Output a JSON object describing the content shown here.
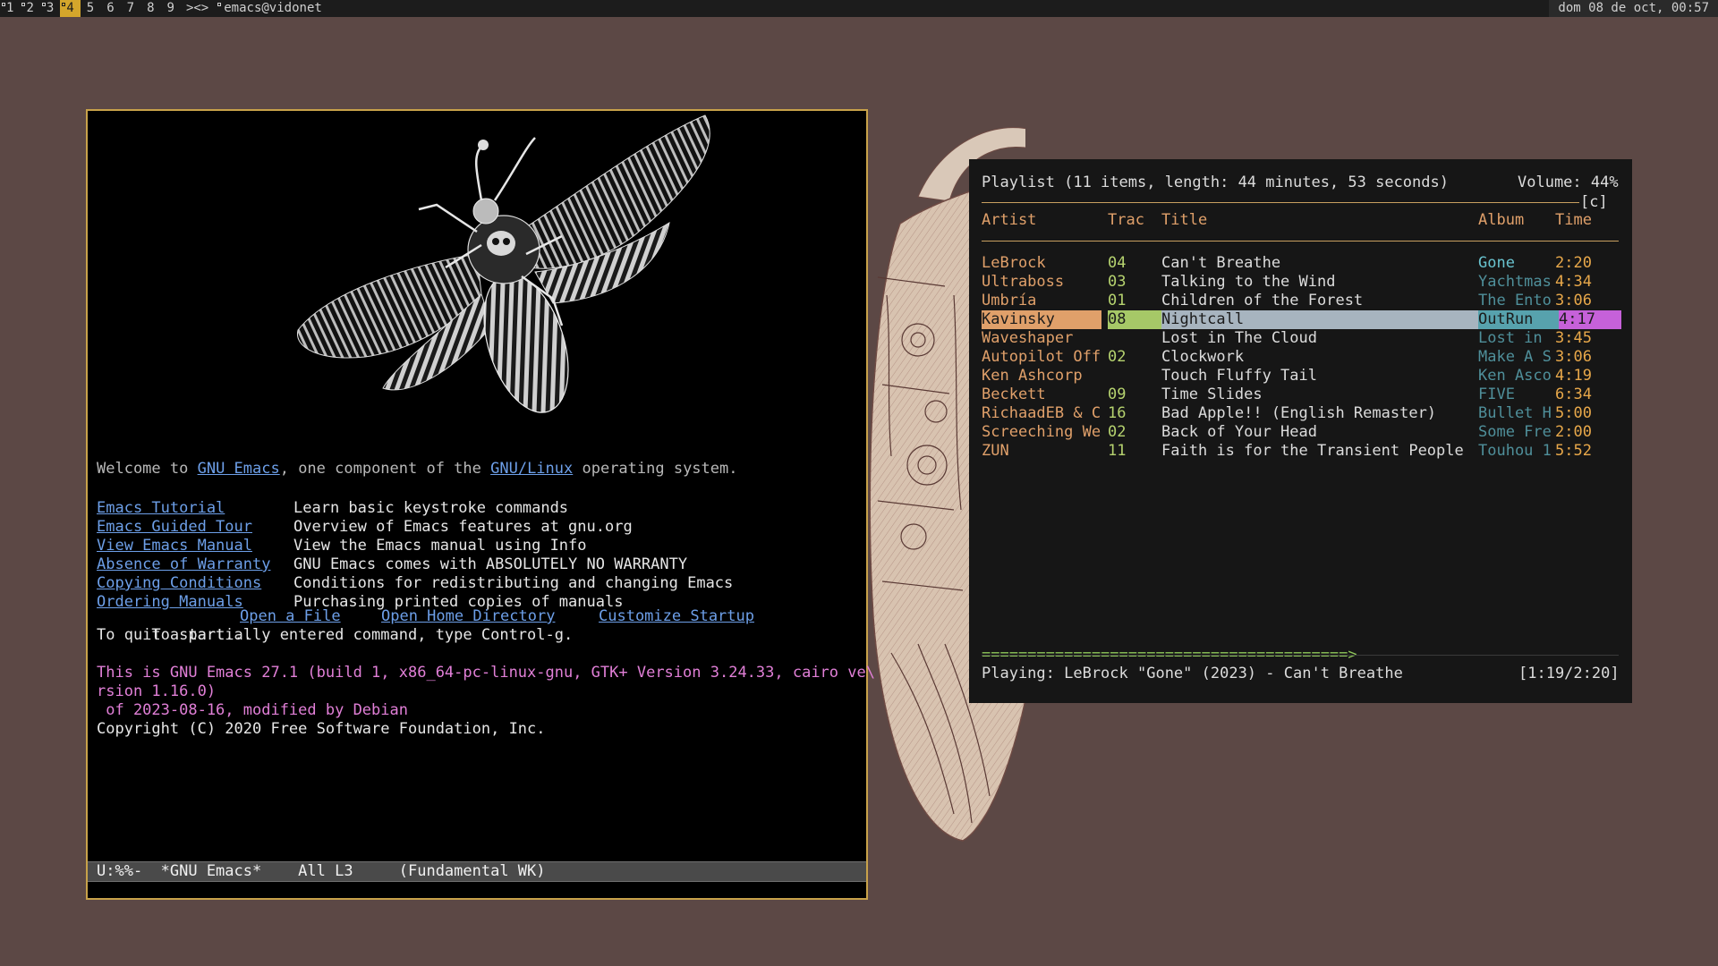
{
  "topbar": {
    "workspaces": [
      {
        "label": "1",
        "has_windows": true,
        "active": false
      },
      {
        "label": "2",
        "has_windows": true,
        "active": false
      },
      {
        "label": "3",
        "has_windows": true,
        "active": false
      },
      {
        "label": "4",
        "has_windows": true,
        "active": true
      },
      {
        "label": "5",
        "has_windows": false,
        "active": false
      },
      {
        "label": "6",
        "has_windows": false,
        "active": false
      },
      {
        "label": "7",
        "has_windows": false,
        "active": false
      },
      {
        "label": "8",
        "has_windows": false,
        "active": false
      },
      {
        "label": "9",
        "has_windows": false,
        "active": false
      }
    ],
    "layout": "><>",
    "window_title": "emacs@vidonet",
    "clock": "dom 08 de oct, 00:57",
    "active_color": "#d4a62b"
  },
  "emacs": {
    "welcome_pre": "Welcome to ",
    "welcome_link1": "GNU Emacs",
    "welcome_mid": ", one component of the ",
    "welcome_link2": "GNU/Linux",
    "welcome_post": " operating system.",
    "menu": [
      {
        "link": "Emacs Tutorial",
        "desc": "Learn basic keystroke commands"
      },
      {
        "link": "Emacs Guided Tour",
        "desc": "Overview of Emacs features at gnu.org"
      },
      {
        "link": "View Emacs Manual",
        "desc": "View the Emacs manual using Info"
      },
      {
        "link": "Absence of Warranty",
        "desc": "GNU Emacs comes with ABSOLUTELY NO WARRANTY"
      },
      {
        "link": "Copying Conditions",
        "desc": "Conditions for redistributing and changing Emacs"
      },
      {
        "link": "Ordering Manuals",
        "desc": "Purchasing printed copies of manuals"
      }
    ],
    "to_start": "To start...",
    "start_links": [
      "Open a File",
      "Open Home Directory",
      "Customize Startup"
    ],
    "quit_hint": "To quit a partially entered command, type Control-g.",
    "version_lines": [
      "This is GNU Emacs 27.1 (build 1, x86_64-pc-linux-gnu, GTK+ Version 3.24.33, cairo ve\\",
      "rsion 1.16.0)",
      " of 2023-08-16, modified by Debian"
    ],
    "copyright": "Copyright (C) 2020 Free Software Foundation, Inc.",
    "modeline": "U:%%-  *GNU Emacs*    All L3     (Fundamental WK)"
  },
  "player": {
    "header": "Playlist (11 items, length: 44 minutes, 53 seconds)",
    "volume": "Volume: 44%",
    "flag": "[c]",
    "columns": {
      "artist": "Artist",
      "track": "Track",
      "title": "Title",
      "album": "Album",
      "time": "Time"
    },
    "rows": [
      {
        "artist": "LeBrock",
        "track": "04",
        "title": "Can't Breathe",
        "album": "Gone",
        "time": "2:20"
      },
      {
        "artist": "Ultraboss",
        "track": "03",
        "title": "Talking to the Wind",
        "album": "Yachtmas",
        "time": "4:34"
      },
      {
        "artist": "Umbría",
        "track": "01",
        "title": "Children of the Forest",
        "album": "The Ento",
        "time": "3:06"
      },
      {
        "artist": "Kavinsky",
        "track": "08",
        "title": "Nightcall",
        "album": "OutRun",
        "time": "4:17"
      },
      {
        "artist": "Waveshaper",
        "track": "",
        "title": "Lost in The Cloud",
        "album": "Lost in",
        "time": "3:45"
      },
      {
        "artist": "Autopilot Off",
        "track": "02",
        "title": "Clockwork",
        "album": "Make A S",
        "time": "3:06"
      },
      {
        "artist": "Ken Ashcorp",
        "track": "",
        "title": "Touch Fluffy Tail",
        "album": "Ken Asco",
        "time": "4:19"
      },
      {
        "artist": "Beckett",
        "track": "09",
        "title": "Time Slides",
        "album": "FIVE",
        "time": "6:34"
      },
      {
        "artist": "RichaadEB & C",
        "track": "16",
        "title": "Bad Apple!! (English Remaster)",
        "album": "Bullet H",
        "time": "5:00"
      },
      {
        "artist": "Screeching We",
        "track": "02",
        "title": "Back of Your Head",
        "album": "Some Fre",
        "time": "2:00"
      },
      {
        "artist": "ZUN",
        "track": "11",
        "title": "Faith is for the Transient People",
        "album": "Touhou 1",
        "time": "5:52"
      }
    ],
    "selected_index": 3,
    "progress_bar": "========================================>",
    "progress": 0.59,
    "now_playing": "Playing: LeBrock \"Gone\" (2023) - Can't Breathe",
    "elapsed": "[1:19/2:20]"
  }
}
